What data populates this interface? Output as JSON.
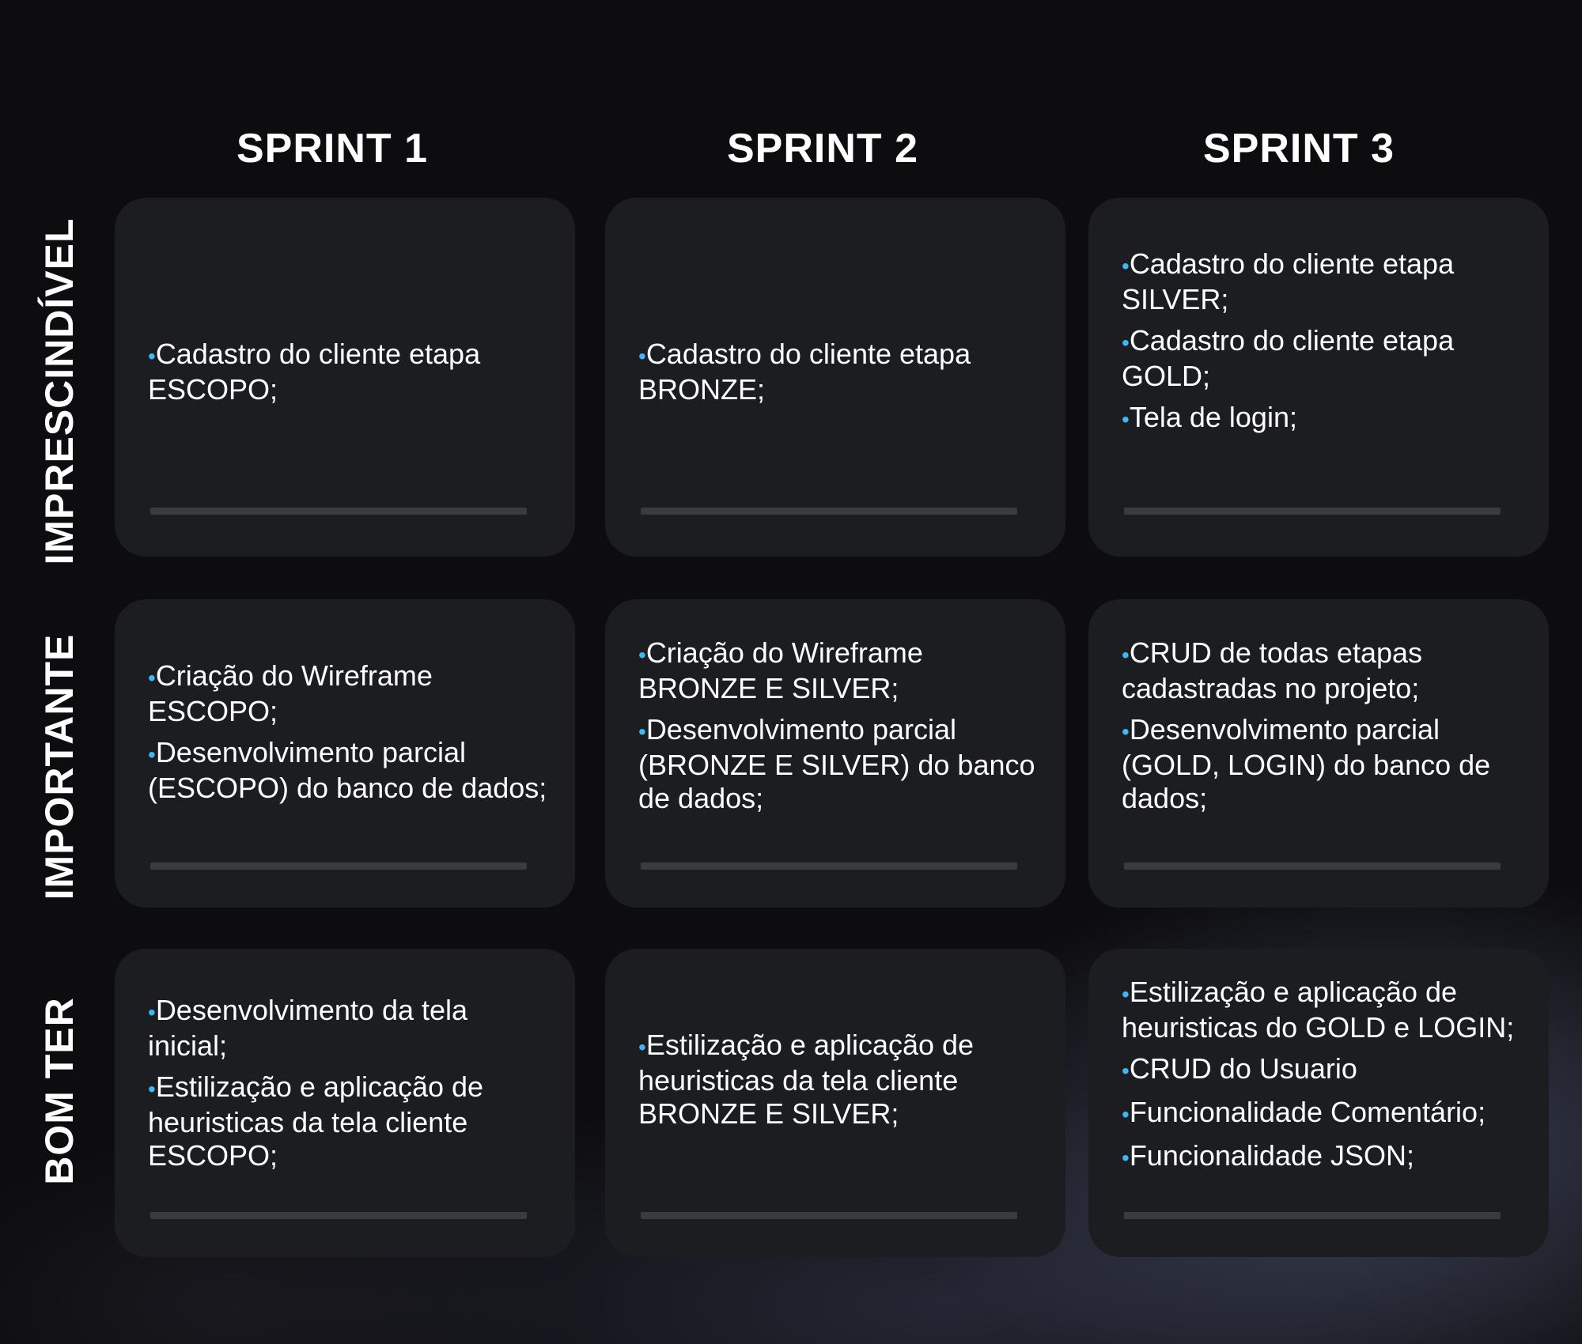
{
  "columns": [
    "SPRINT 1",
    "SPRINT 2",
    "SPRINT 3"
  ],
  "rows": [
    "IMPRESCINDÍVEL",
    "IMPORTANTE",
    "BOM TER"
  ],
  "bullet_symbol": "•",
  "bullet_color": "#3bb8f5",
  "cells": [
    [
      [
        "Cadastro do cliente etapa ESCOPO;"
      ],
      [
        "Cadastro do cliente etapa BRONZE;"
      ],
      [
        "Cadastro do cliente etapa SILVER;",
        "Cadastro do cliente etapa GOLD;",
        "Tela de login;"
      ]
    ],
    [
      [
        "Criação do Wireframe ESCOPO;",
        "Desenvolvimento parcial (ESCOPO) do banco de dados;"
      ],
      [
        "Criação do Wireframe BRONZE E SILVER;",
        "Desenvolvimento parcial (BRONZE E SILVER) do banco de dados;"
      ],
      [
        "CRUD de todas etapas cadastradas no projeto;",
        "Desenvolvimento parcial (GOLD, LOGIN) do banco de dados;"
      ]
    ],
    [
      [
        "Desenvolvimento da tela inicial;",
        "Estilização e aplicação de heuristicas da tela cliente ESCOPO;"
      ],
      [
        "Estilização e aplicação de heuristicas da tela cliente BRONZE E SILVER;"
      ],
      [
        "Estilização e aplicação de heuristicas do GOLD e LOGIN;",
        "CRUD do Usuario",
        "Funcionalidade Comentário;",
        "Funcionalidade JSON;"
      ]
    ]
  ]
}
